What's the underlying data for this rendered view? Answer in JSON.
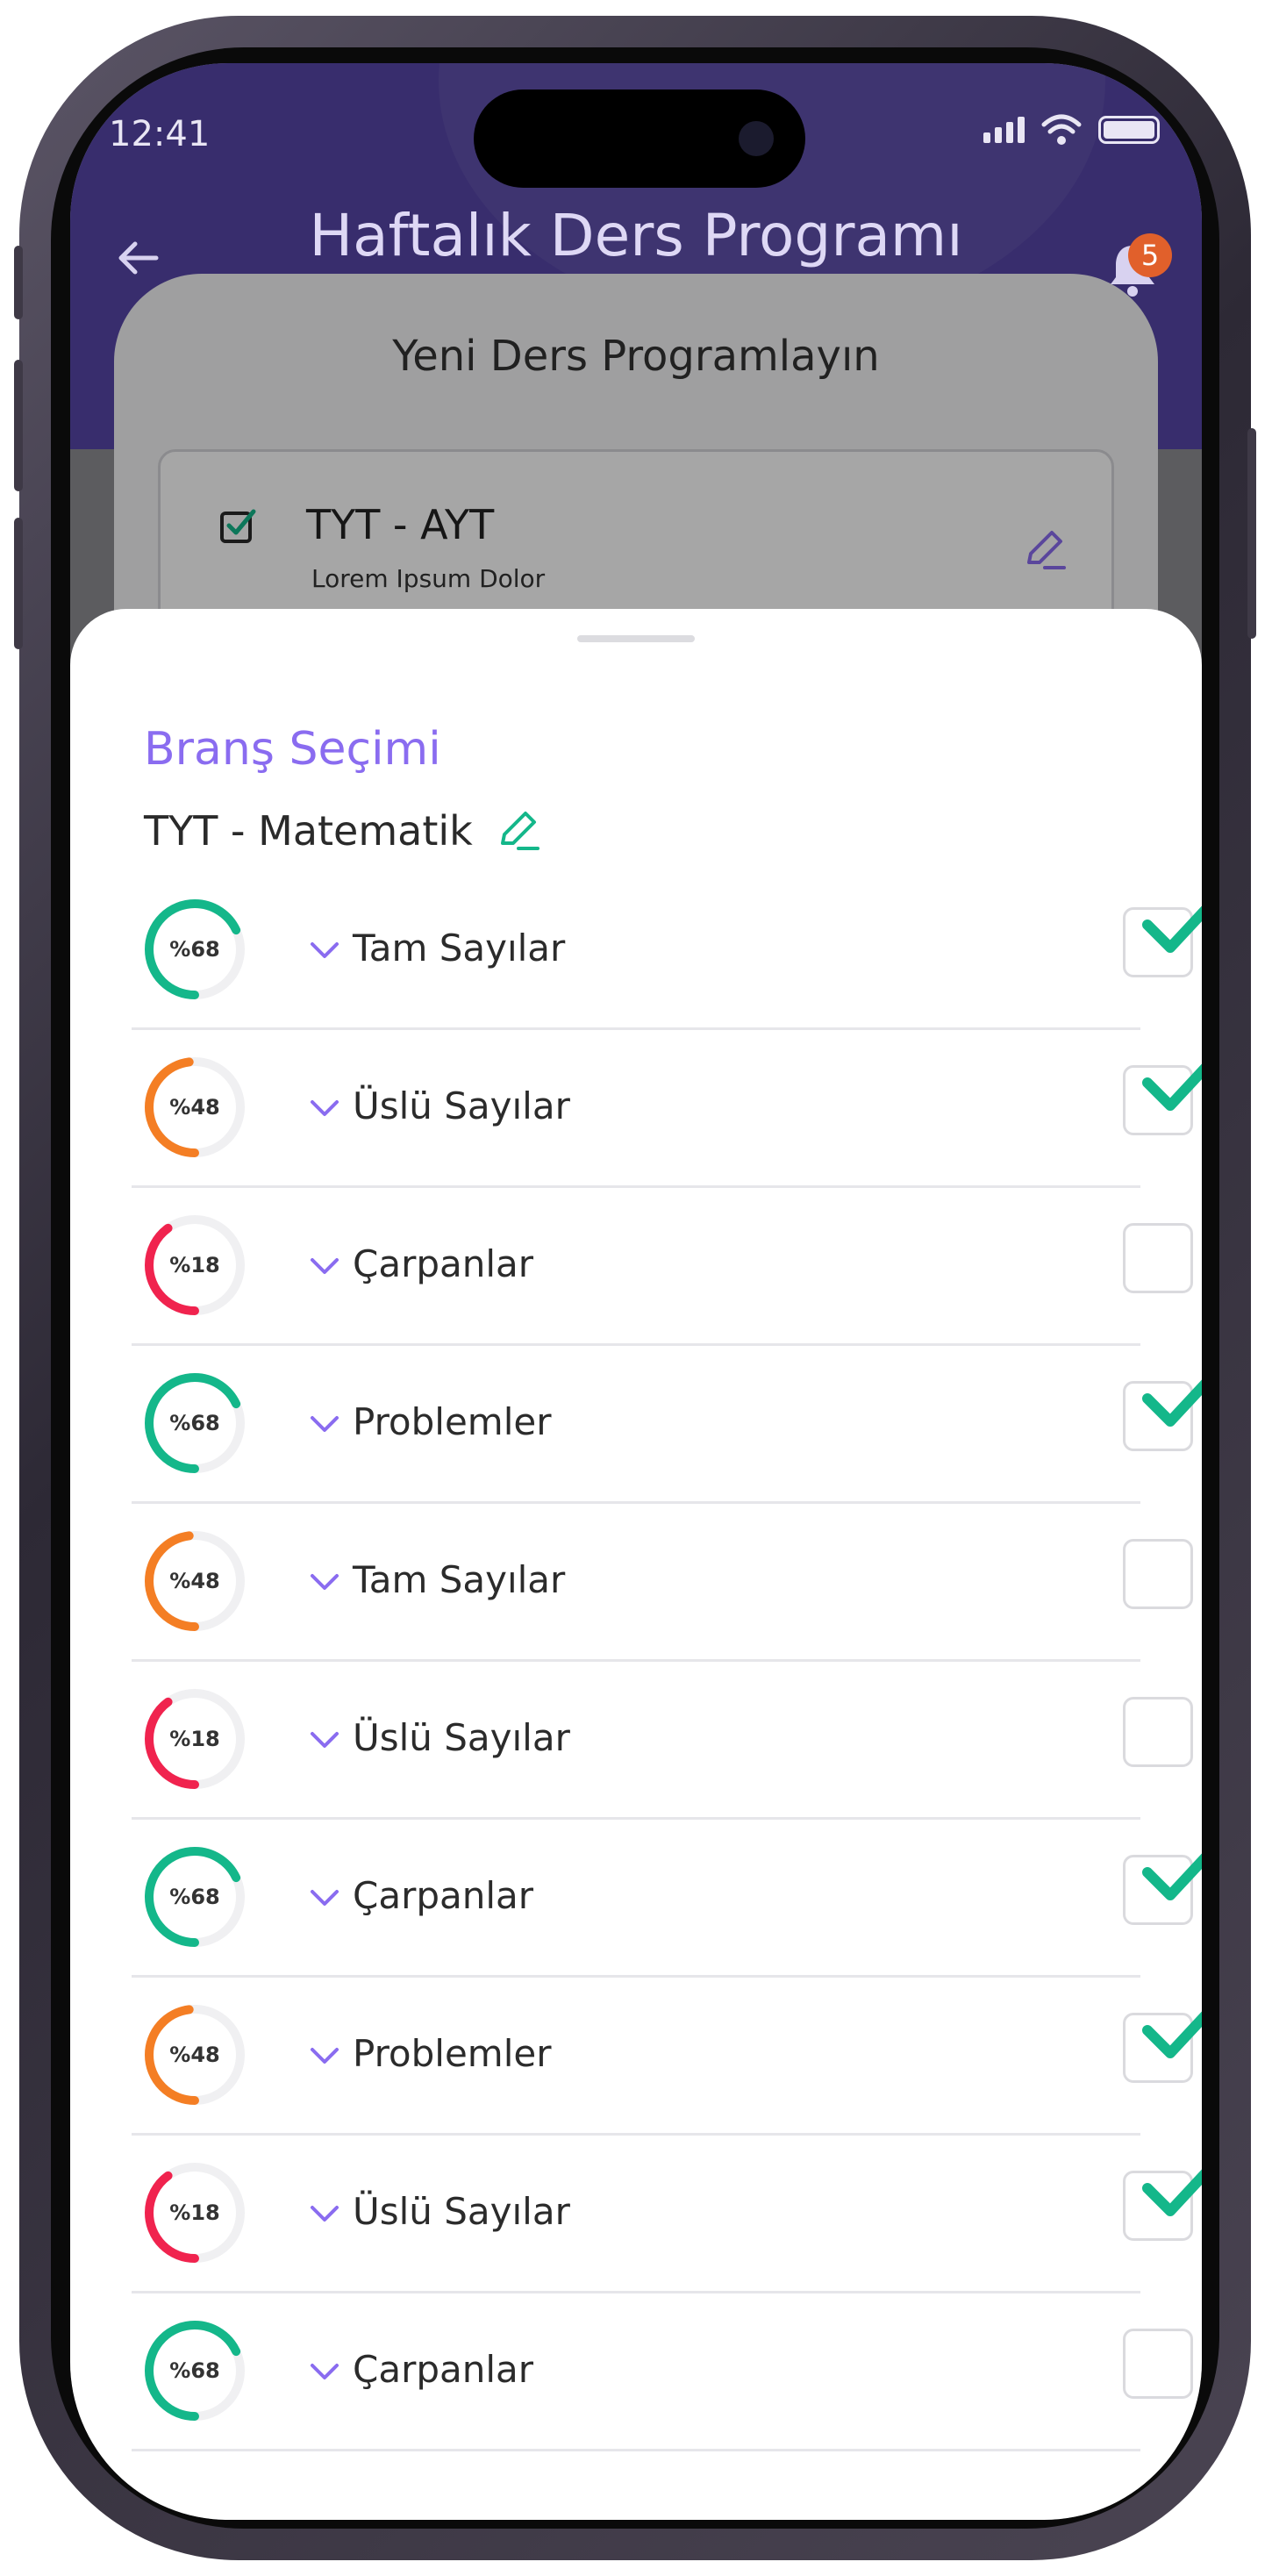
{
  "status": {
    "time": "12:41"
  },
  "header": {
    "title": "Haftalık Ders Programı",
    "notification_count": "5"
  },
  "card": {
    "title": "Yeni Ders Programlayın",
    "item_title": "TYT - AYT",
    "item_subtitle": "Lorem Ipsum Dolor"
  },
  "sheet": {
    "section_title": "Branş Seçimi",
    "subject": "TYT - Matematik",
    "topics": [
      {
        "label": "Tam Sayılar",
        "percent": "%68",
        "value": 68,
        "color": "#14b78a",
        "checked": true
      },
      {
        "label": "Üslü Sayılar",
        "percent": "%48",
        "value": 48,
        "color": "#f47e24",
        "checked": true
      },
      {
        "label": "Çarpanlar",
        "percent": "%18",
        "value": 18,
        "color": "#f0234e",
        "checked": false
      },
      {
        "label": "Problemler",
        "percent": "%68",
        "value": 68,
        "color": "#14b78a",
        "checked": true
      },
      {
        "label": "Tam Sayılar",
        "percent": "%48",
        "value": 48,
        "color": "#f47e24",
        "checked": false
      },
      {
        "label": "Üslü Sayılar",
        "percent": "%18",
        "value": 18,
        "color": "#f0234e",
        "checked": false
      },
      {
        "label": "Çarpanlar",
        "percent": "%68",
        "value": 68,
        "color": "#14b78a",
        "checked": true
      },
      {
        "label": "Problemler",
        "percent": "%48",
        "value": 48,
        "color": "#f47e24",
        "checked": true
      },
      {
        "label": "Üslü Sayılar",
        "percent": "%18",
        "value": 18,
        "color": "#f0234e",
        "checked": true
      },
      {
        "label": "Çarpanlar",
        "percent": "%68",
        "value": 68,
        "color": "#14b78a",
        "checked": false
      }
    ]
  },
  "icons": {
    "back": "back-arrow-icon",
    "notification": "bell-icon",
    "checkbox": "checkbox-checked-icon",
    "edit": "pencil-icon",
    "expand": "chevron-down-icon",
    "check": "checkmark-icon"
  },
  "colors": {
    "header": "#5746a8",
    "accent": "#8a6cf0",
    "green": "#14b78a",
    "orange": "#f47e24",
    "red": "#f0234e"
  }
}
